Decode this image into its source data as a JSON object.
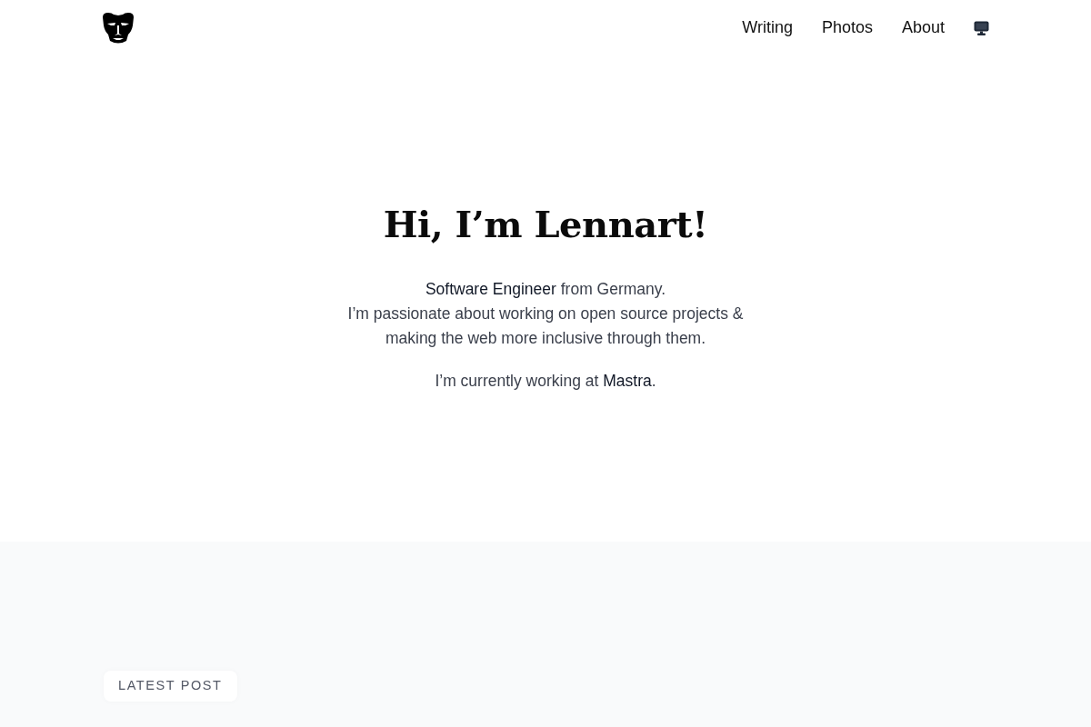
{
  "nav": {
    "links": [
      "Writing",
      "Photos",
      "About"
    ]
  },
  "hero": {
    "title": "Hi, I’m Lennart!",
    "intro": "**Software Engineer** from Germany.\nI’m passionate about working on open source projects &\nmaking the web more inclusive through them.",
    "job": {
      "text": "I’m currently working at ",
      "link": "Mastra",
      "after": "."
    }
  },
  "latest": {
    "label": "LATEST POST"
  }
}
